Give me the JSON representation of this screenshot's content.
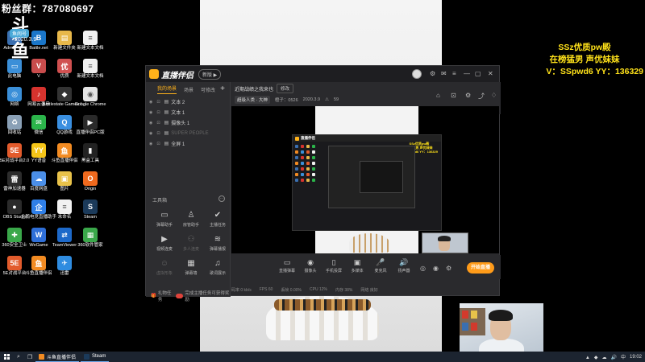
{
  "overlay": {
    "fans_text": "粉丝群：787080697",
    "logo_big": "斗鱼",
    "logo_pill": "鱼闹号",
    "logo_year": "2020.3.9",
    "promo": {
      "line1": "SSz优质pw殿",
      "line2": "在榜猛男 声优妹妹",
      "line3": "V：SSpwd6  YY：136329"
    }
  },
  "desktop_icons": [
    {
      "label": "Administr...",
      "color": "#3a6fb0",
      "glyph": "A"
    },
    {
      "label": "Battle.net",
      "color": "#1a76c9",
      "glyph": "B"
    },
    {
      "label": "新建文件夹",
      "color": "#e8b84a",
      "glyph": "▤"
    },
    {
      "label": "新建文本文档",
      "color": "#f1f1f1",
      "glyph": "≡"
    },
    {
      "label": "此电脑",
      "color": "#3b8fd8",
      "glyph": "▭"
    },
    {
      "label": "V",
      "color": "#c84c4c",
      "glyph": "V"
    },
    {
      "label": "优质",
      "color": "#d05050",
      "glyph": "优"
    },
    {
      "label": "新建文本文档",
      "color": "#f1f1f1",
      "glyph": "≡"
    },
    {
      "label": "网络",
      "color": "#3b8fd8",
      "glyph": "◎"
    },
    {
      "label": "网易云音乐",
      "color": "#d6332e",
      "glyph": "♪"
    },
    {
      "label": "Battlestate Games L...",
      "color": "#333333",
      "glyph": "◆"
    },
    {
      "label": "Google Chrome",
      "color": "#e4e4e4",
      "glyph": "◉"
    },
    {
      "label": "回收站",
      "color": "#8aa0b6",
      "glyph": "♻"
    },
    {
      "label": "微信",
      "color": "#2bb44a",
      "glyph": "✉"
    },
    {
      "label": "QQ游戏",
      "color": "#3a8fe0",
      "glyph": "Q"
    },
    {
      "label": "直播伴侣PC版",
      "color": "#2a2a2a",
      "glyph": "▶"
    },
    {
      "label": "5E对战平台2.0",
      "color": "#e25b2c",
      "glyph": "5E"
    },
    {
      "label": "YY语音",
      "color": "#f5c518",
      "glyph": "YY"
    },
    {
      "label": "斗鱼直播伴侣",
      "color": "#f28b22",
      "glyph": "鱼"
    },
    {
      "label": "黑盒工具",
      "color": "#222222",
      "glyph": "▮"
    },
    {
      "label": "雷神加速器",
      "color": "#2c2c2c",
      "glyph": "雷"
    },
    {
      "label": "百度网盘",
      "color": "#4b8fe8",
      "glyph": "☁"
    },
    {
      "label": "图片",
      "color": "#e8c24a",
      "glyph": "▣"
    },
    {
      "label": "Origin",
      "color": "#f06a1e",
      "glyph": "O"
    },
    {
      "label": "OBS Studio",
      "color": "#2b2b2b",
      "glyph": "●"
    },
    {
      "label": "企鹅电竞直播助手",
      "color": "#2f7fe8",
      "glyph": "企"
    },
    {
      "label": "未命名",
      "color": "#f1f1f1",
      "glyph": "≡"
    },
    {
      "label": "Steam",
      "color": "#1b3a5a",
      "glyph": "S"
    },
    {
      "label": "360安全卫士",
      "color": "#3aa84a",
      "glyph": "✚"
    },
    {
      "label": "WeGame",
      "color": "#2f6fd8",
      "glyph": "W"
    },
    {
      "label": "TeamViewer",
      "color": "#1d69c9",
      "glyph": "⇄"
    },
    {
      "label": "360软件管家",
      "color": "#3aa84a",
      "glyph": "▦"
    },
    {
      "label": "5E对战平台",
      "color": "#e25b2c",
      "glyph": "5E"
    },
    {
      "label": "斗鱼直播伴侣",
      "color": "#f28b22",
      "glyph": "鱼"
    },
    {
      "label": "迅雷",
      "color": "#2f8ce0",
      "glyph": "✈"
    }
  ],
  "app": {
    "name": "直播伴侣",
    "version_pill": "新版 ▶",
    "scene_tabs": [
      "我的场景",
      "场景",
      "可修改"
    ],
    "sources": [
      {
        "label": "文本 2",
        "dim": false
      },
      {
        "label": "文本 1",
        "dim": false
      },
      {
        "label": "摄像头 1",
        "dim": false
      },
      {
        "label": "SUPER PEOPLE",
        "dim": true
      },
      {
        "label": "全屏 1",
        "dim": false
      }
    ],
    "tools_title": "工具箱",
    "tools": [
      {
        "label": "弹幕助手",
        "icon": "▭",
        "dim": false
      },
      {
        "label": "房管助手",
        "icon": "♙",
        "dim": false
      },
      {
        "label": "主播任务",
        "icon": "✔",
        "dim": false
      },
      {
        "label": "视频连麦",
        "icon": "▶",
        "dim": false
      },
      {
        "label": "多人连麦",
        "icon": "⚇",
        "dim": true
      },
      {
        "label": "弹幕播报",
        "icon": "≋",
        "dim": false
      },
      {
        "label": "虚拟形象",
        "icon": "☺",
        "dim": true
      },
      {
        "label": "弹幕墙",
        "icon": "▦",
        "dim": false
      },
      {
        "label": "歌词展示",
        "icon": "♫",
        "dim": false
      }
    ],
    "task_text": "礼物任务",
    "task_sub": "完成主播任务可获得奖励",
    "room_title": "近期战绩之我来也",
    "edit_label": "修改",
    "category": "超级人类 · 大神",
    "meta": [
      "橙子：0526",
      "2020.3.9"
    ],
    "viewer_icon": "⚠",
    "viewer_count": "59",
    "toolbar": [
      {
        "label": "直播弹幕",
        "icon": "▭"
      },
      {
        "label": "摄像头",
        "icon": "◉"
      },
      {
        "label": "手机投屏",
        "icon": "▯"
      },
      {
        "label": "多媒体",
        "icon": "▣"
      },
      {
        "label": "麦克风",
        "icon": "🎤"
      },
      {
        "label": "扬声器",
        "icon": "🔊"
      }
    ],
    "start_live": "开始直播",
    "status": [
      {
        "text": "码率 0 kb/s",
        "warn": false
      },
      {
        "text": "FPS 60",
        "warn": false
      },
      {
        "text": "丢帧 0.00%",
        "warn": false
      },
      {
        "text": "CPU 12%",
        "warn": false
      },
      {
        "text": "内存 38%",
        "warn": false
      },
      {
        "text": "网络 良好",
        "warn": false
      }
    ]
  },
  "nested": {
    "app_name": "直播伴侣",
    "promo_lines": [
      "SSz优质pw殿",
      "在榜猛男 声优妹妹",
      "V：SSpwd6  YY：136329"
    ]
  },
  "taskbar": {
    "items": [
      {
        "label": "斗鱼直播伴侣",
        "color": "#f28b22"
      },
      {
        "label": "Steam",
        "color": "#1b3a5a"
      }
    ],
    "tray_icons": [
      "▲",
      "◆",
      "☁",
      "🔊",
      "中"
    ],
    "time": "19:02"
  }
}
